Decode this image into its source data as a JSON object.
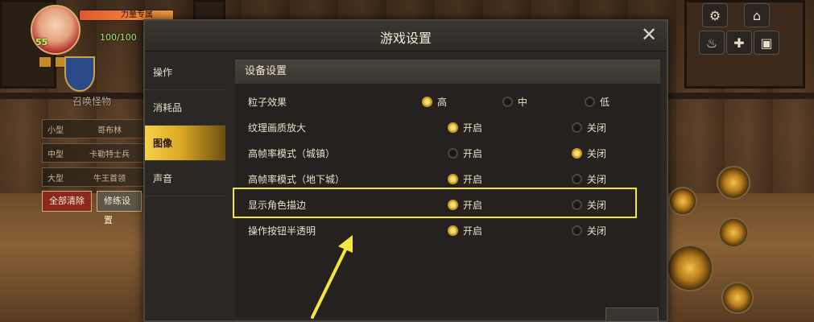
{
  "hud": {
    "level": "55",
    "mp": "100/100",
    "hp_label": "力量专属",
    "summon": {
      "title": "召唤怪物",
      "rows": [
        {
          "size": "小型",
          "name": "哥布林"
        },
        {
          "size": "中型",
          "name": "卡勒特士兵"
        },
        {
          "size": "大型",
          "name": "牛王首领"
        }
      ],
      "clear_all_label": "全部清除",
      "modify_label": "修练设置"
    }
  },
  "dialog": {
    "title": "游戏设置",
    "tabs": [
      {
        "label": "操作"
      },
      {
        "label": "消耗品"
      },
      {
        "label": "图像"
      },
      {
        "label": "声音"
      }
    ],
    "active_tab": "图像",
    "section_title": "设备设置",
    "settings": [
      {
        "label": "粒子效果",
        "options": [
          "高",
          "中",
          "低"
        ],
        "selected": 0
      },
      {
        "label": "纹理画质放大",
        "options": [
          "开启",
          "关闭"
        ],
        "selected": 0
      },
      {
        "label": "高帧率模式（城镇）",
        "options": [
          "开启",
          "关闭"
        ],
        "selected": 1
      },
      {
        "label": "高帧率模式（地下城）",
        "options": [
          "开启",
          "关闭"
        ],
        "selected": 0
      },
      {
        "label": "显示角色描边",
        "options": [
          "开启",
          "关闭"
        ],
        "selected": 0
      },
      {
        "label": "操作按钮半透明",
        "options": [
          "开启",
          "关闭"
        ],
        "selected": 0
      }
    ]
  },
  "colors": {
    "accent_gold": "#f4d04a",
    "highlight_yellow": "#f4e640",
    "panel_bg": "#2a2724"
  }
}
